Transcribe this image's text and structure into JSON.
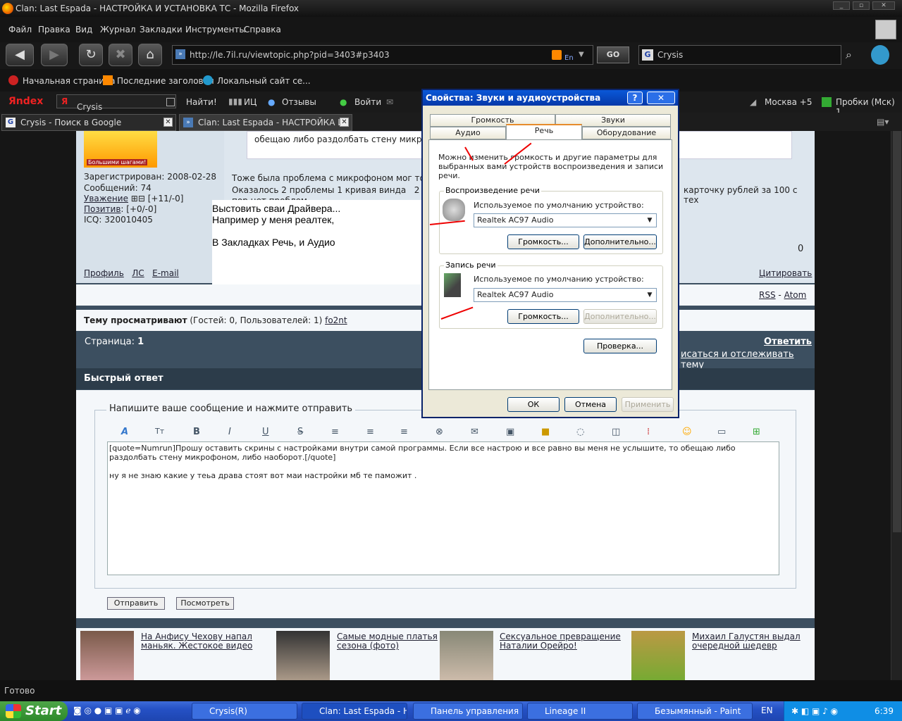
{
  "window": {
    "title": "Clan: Last Espada - НАСТРОЙКА И УСТАНОВКА ТС - Mozilla Firefox"
  },
  "menu": [
    "Файл",
    "Правка",
    "Вид",
    "Журнал",
    "Закладки",
    "Инструменты",
    "Справка"
  ],
  "nav": {
    "url": "http://le.7il.ru/viewtopic.php?pid=3403#p3403",
    "go": "GO",
    "search_value": "Crysis"
  },
  "bookmarks": [
    "Начальная страница",
    "Последние заголовки",
    "Локальный сайт се..."
  ],
  "yandex": {
    "logo": "Яndex",
    "search": "Crysis",
    "find": "Найти!",
    "ic": "ИЦ",
    "reviews": "Отзывы",
    "login": "Войти",
    "city": "Москва +5",
    "traffic": "Пробки (Мск) 1"
  },
  "tabs": [
    {
      "label": "Crysis - Поиск в Google"
    },
    {
      "label": "Clan: Last Espada - НАСТРОЙКА И ..."
    }
  ],
  "post": {
    "avatar_caption": "Большими шагами!",
    "registered": "Зарегистрирован: 2008-02-28",
    "messages": "Сообщений: 74",
    "respect_label": "Уважение",
    "respect_value": "[+11/-0]",
    "positive_label": "Позитив",
    "positive_value": ": [+0/-0]",
    "icq": "ICQ: 320010405",
    "quote_tail": "обещаю либо раздолбать стену микроф",
    "body_line1": "Тоже была проблема с микрофоном мог тольк",
    "body_line2": "Оказалось 2 проблемы 1 кривая винда   2 уб",
    "body_line3": "пор нет проблем",
    "body_right": "карточку рублей за 100 с тех",
    "overlay_lines": [
      "Выстовить сваи Драйвера...",
      "Например у меня реалтек,",
      "",
      "В Закладках Речь, и Аудио"
    ],
    "counter": "0",
    "links": [
      "Профиль",
      "ЛС",
      "E-mail"
    ],
    "quote_link": "Цитировать"
  },
  "feeds": {
    "rss": "RSS",
    "sep": "-",
    "atom": "Atom"
  },
  "viewers": {
    "label": "Тему просматривают",
    "info": "(Гостей: 0, Пользователей: 1)",
    "user": "fo2nt"
  },
  "pages": {
    "label": "Страница:",
    "number": "1",
    "reply": "Ответить",
    "subscribe": "исаться и отслеживать тему"
  },
  "quick": {
    "title": "Быстрый ответ",
    "legend": "Напишите ваше сообщение и нажмите отправить",
    "text_line1": "[quote=Numrun]Прошу оставить скрины с настройками внутри самой программы. Если все настрою и все равно вы меня не услышите, то обещаю либо",
    "text_line2": "раздолбать стену микрофоном, либо наоборот.[/quote]",
    "text_line3": "ну я не знаю какие у теьа драва стоят вот маи настройки мб те паможит .",
    "send": "Отправить",
    "preview": "Посмотреть"
  },
  "news": [
    {
      "line1": "На Анфису Чехову напал",
      "line2": "маньяк. Жестокое видео"
    },
    {
      "line1": "Самые модные платья",
      "line2": "сезона (фото)"
    },
    {
      "line1": "Сексуальное превращение",
      "line2": "Наталии Орейро!"
    },
    {
      "line1": "Михаил Галустян выдал",
      "line2": "очередной шедевр"
    }
  ],
  "dialog": {
    "title": "Свойства: Звуки и аудиоустройства",
    "tabs_top": [
      "Громкость",
      "Звуки"
    ],
    "tabs_bottom": [
      "Аудио",
      "Речь",
      "Оборудование"
    ],
    "desc_line1": "Можно изменить громкость и другие параметры для",
    "desc_line2": "выбранных вами устройств воспроизведения и записи речи.",
    "playback": {
      "group": "Воспроизведение речи",
      "label": "Используемое по умолчанию устройство:",
      "device": "Realtek AC97 Audio",
      "volume": "Громкость...",
      "advanced": "Дополнительно..."
    },
    "record": {
      "group": "Запись речи",
      "label": "Используемое по умолчанию устройство:",
      "device": "Realtek AC97 Audio",
      "volume": "Громкость...",
      "advanced": "Дополнительно..."
    },
    "test": "Проверка...",
    "ok": "ОК",
    "cancel": "Отмена",
    "apply": "Применить"
  },
  "status": "Готово",
  "taskbar": {
    "start": "Start",
    "items": [
      "Crysis(R)",
      "Clan: Last Espada - Н...",
      "Панель управления",
      "Lineage II",
      "Безымянный - Paint"
    ],
    "lang": "EN",
    "clock": "6:39"
  }
}
